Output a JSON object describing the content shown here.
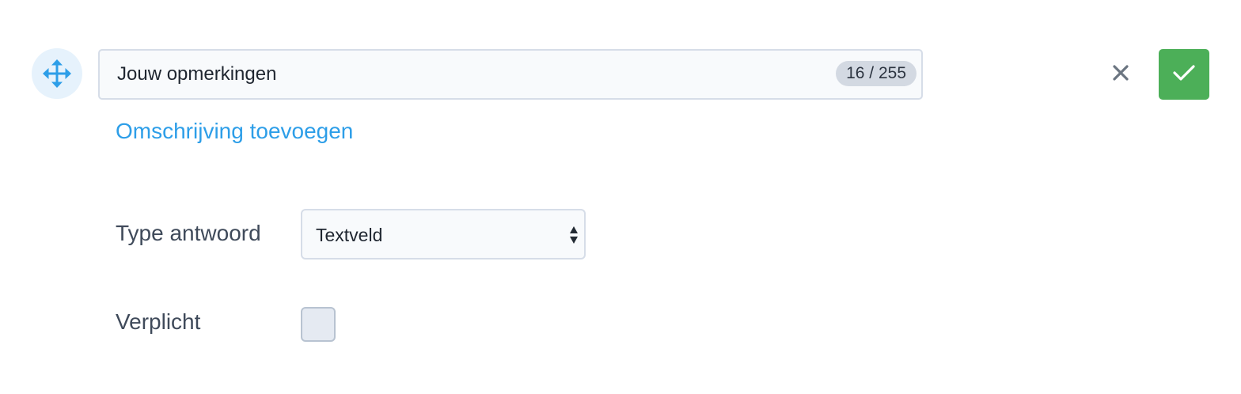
{
  "question": {
    "title_value": "Jouw opmerkingen",
    "char_counter": "16 / 255",
    "add_description_label": "Omschrijving toevoegen"
  },
  "actions": {
    "cancel_icon": "close-icon",
    "confirm_icon": "check-icon",
    "drag_icon": "move-icon"
  },
  "answer_type": {
    "label": "Type antwoord",
    "selected_value": "Textveld"
  },
  "required": {
    "label": "Verplicht",
    "checked": false
  },
  "colors": {
    "accent": "#2d9ee8",
    "confirm": "#4caf58",
    "text": "#3f4a5a"
  }
}
